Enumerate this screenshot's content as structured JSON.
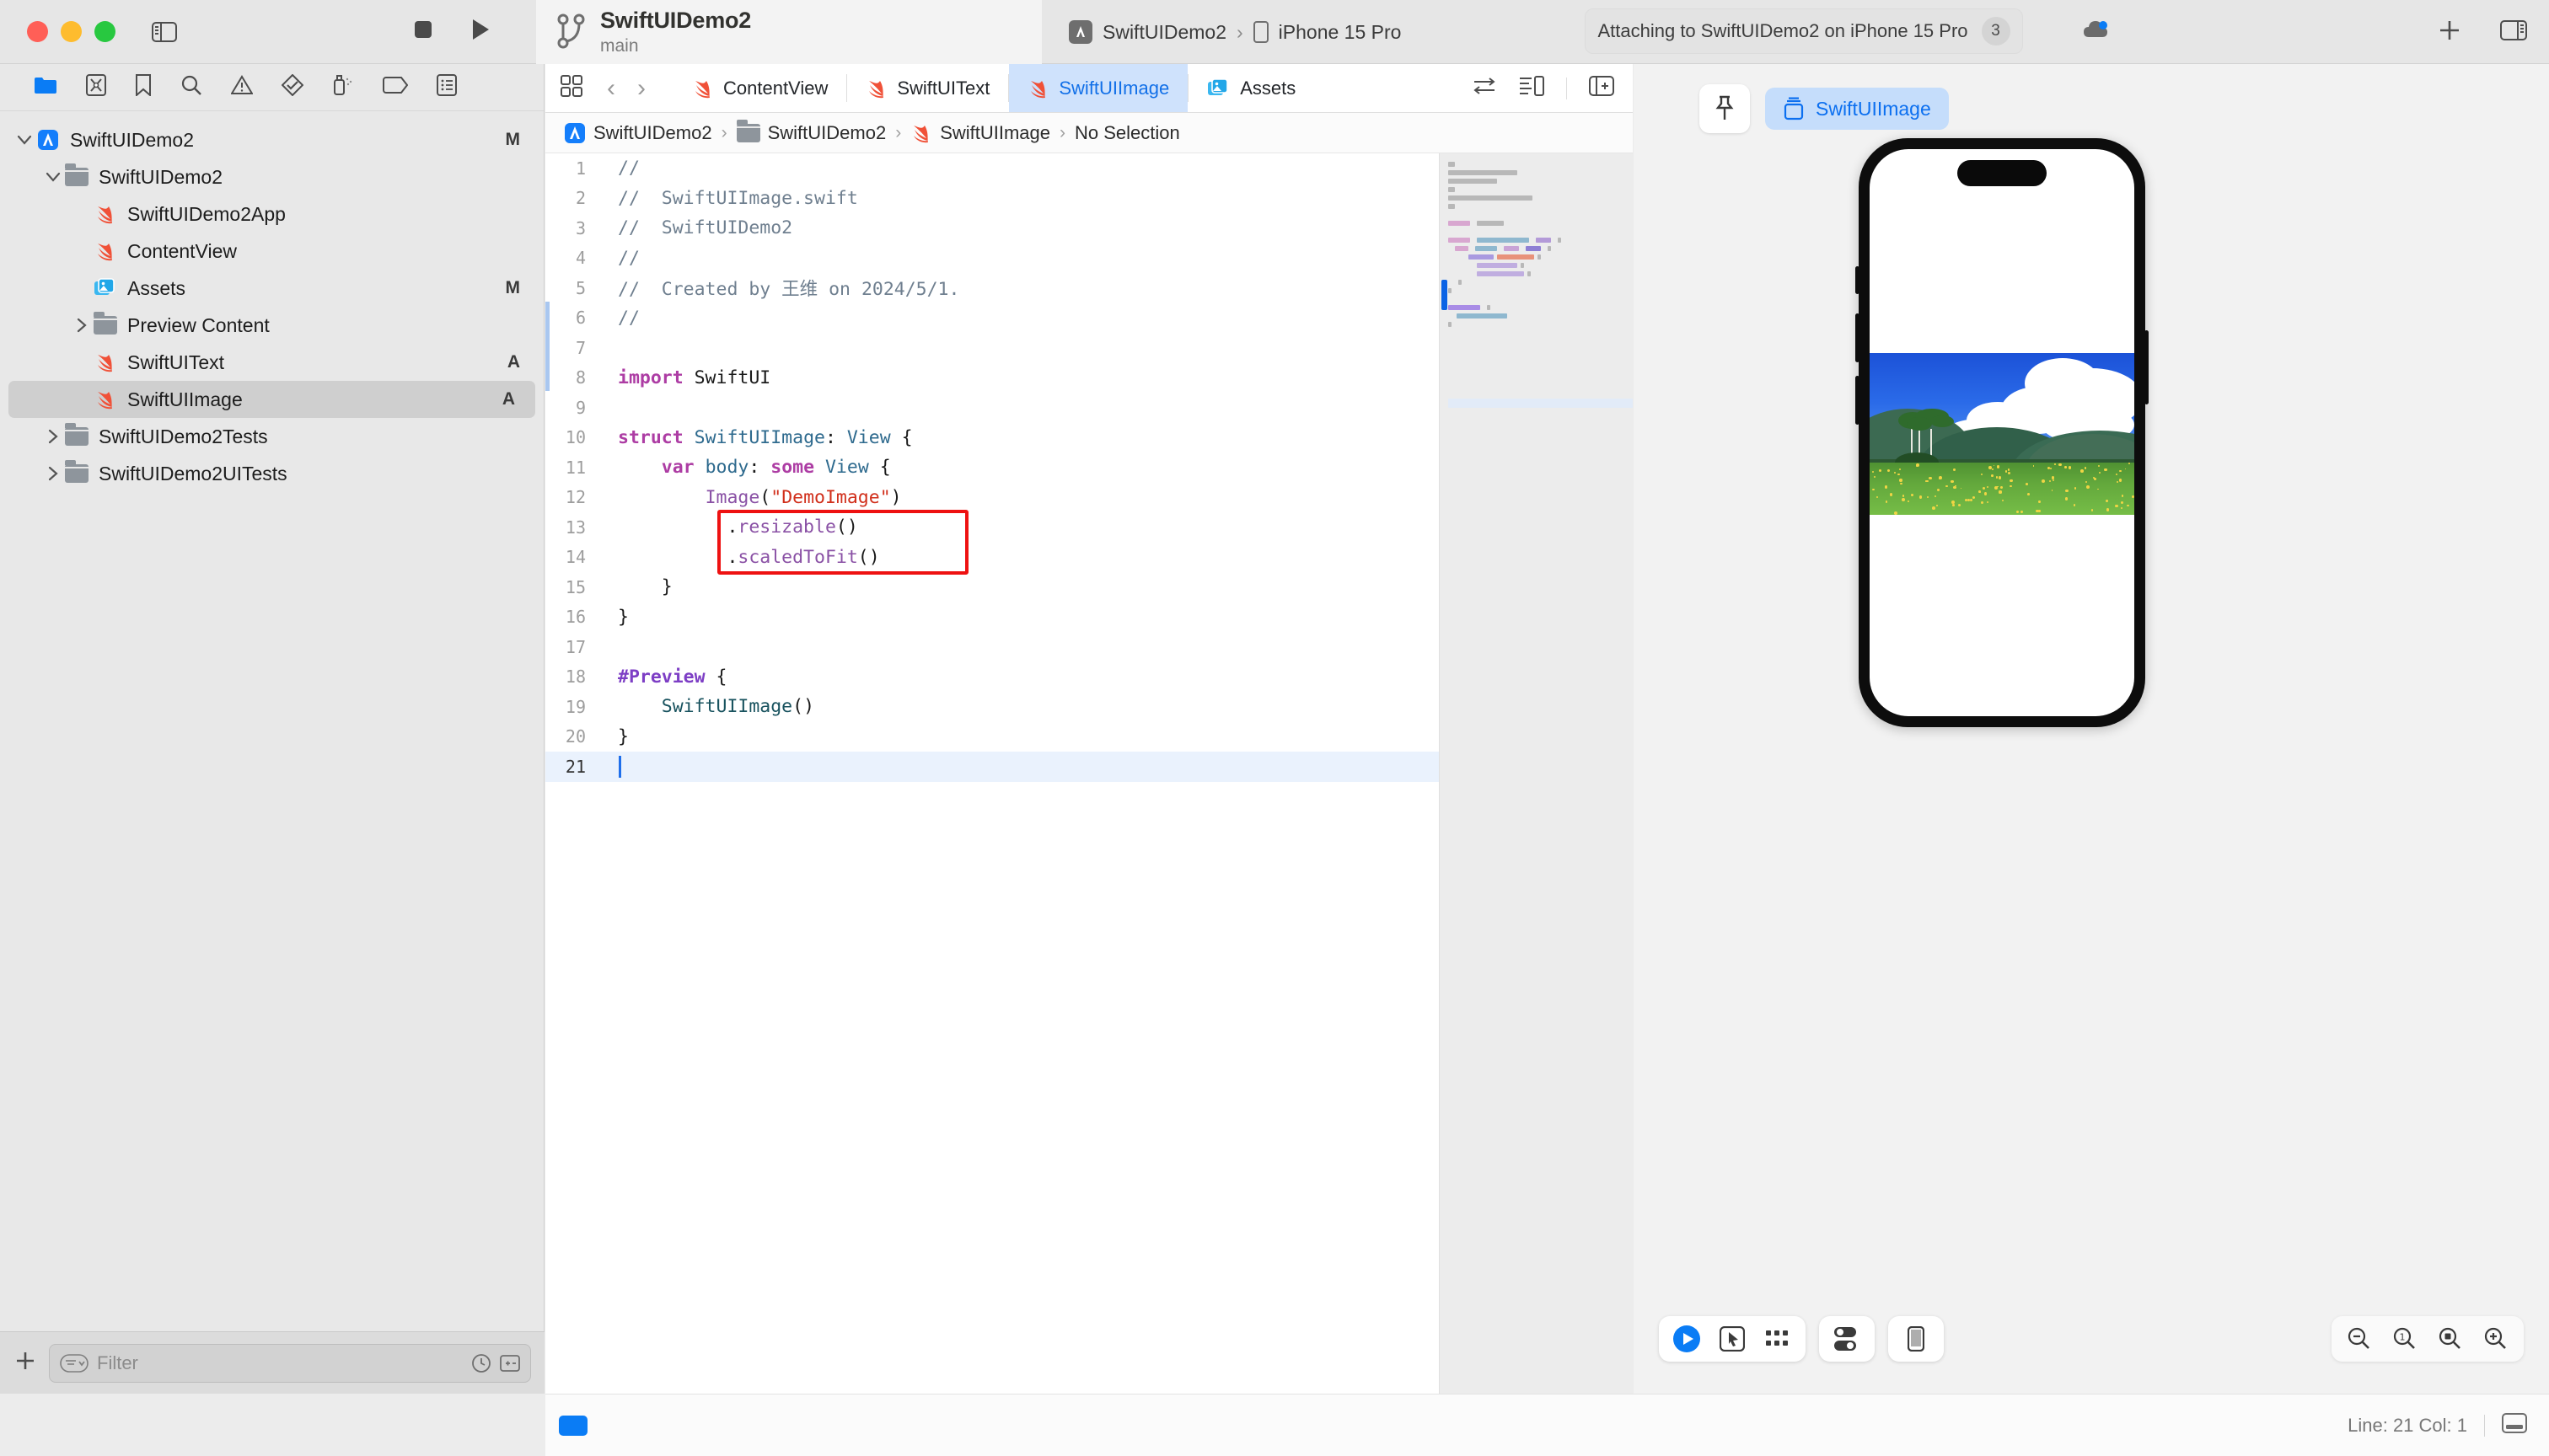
{
  "window": {
    "traffic_lights": [
      "close",
      "minimize",
      "zoom"
    ],
    "project_name": "SwiftUIDemo2",
    "branch": "main",
    "run_button": "run",
    "stop_button": "stop",
    "sidebar_toggle": "toggle-sidebar"
  },
  "destination": {
    "scheme": "SwiftUIDemo2",
    "separator": "›",
    "device": "iPhone 15 Pro"
  },
  "activity": {
    "message": "Attaching to SwiftUIDemo2 on iPhone 15 Pro",
    "issue_count": "3"
  },
  "toolbar_right": {
    "cloud": "cloud-icon",
    "add": "+",
    "inspector_toggle": "toggle-inspector"
  },
  "navigator": {
    "tabs": [
      {
        "name": "project-navigator",
        "icon": "folder-icon",
        "active": true
      },
      {
        "name": "source-control-navigator",
        "icon": "source-control-icon",
        "active": false
      },
      {
        "name": "bookmark-navigator",
        "icon": "bookmark-icon",
        "active": false
      },
      {
        "name": "find-navigator",
        "icon": "search-icon",
        "active": false
      },
      {
        "name": "issue-navigator",
        "icon": "warning-icon",
        "active": false
      },
      {
        "name": "test-navigator",
        "icon": "diamond-check-icon",
        "active": false
      },
      {
        "name": "debug-navigator",
        "icon": "spray-icon",
        "active": false
      },
      {
        "name": "breakpoint-navigator",
        "icon": "tag-icon",
        "active": false
      },
      {
        "name": "report-navigator",
        "icon": "report-icon",
        "active": false
      }
    ],
    "tree": [
      {
        "label": "SwiftUIDemo2",
        "icon": "xcode-project-icon",
        "depth": 0,
        "disclosure": "open",
        "status": "M",
        "selected": false
      },
      {
        "label": "SwiftUIDemo2",
        "icon": "folder-icon",
        "depth": 1,
        "disclosure": "open",
        "status": "",
        "selected": false
      },
      {
        "label": "SwiftUIDemo2App",
        "icon": "swift-file-icon",
        "depth": 2,
        "disclosure": "",
        "status": "",
        "selected": false
      },
      {
        "label": "ContentView",
        "icon": "swift-file-icon",
        "depth": 2,
        "disclosure": "",
        "status": "",
        "selected": false
      },
      {
        "label": "Assets",
        "icon": "assets-icon",
        "depth": 2,
        "disclosure": "",
        "status": "M",
        "selected": false
      },
      {
        "label": "Preview Content",
        "icon": "folder-icon",
        "depth": 2,
        "disclosure": "closed",
        "status": "",
        "selected": false
      },
      {
        "label": "SwiftUIText",
        "icon": "swift-file-icon",
        "depth": 2,
        "disclosure": "",
        "status": "A",
        "selected": false
      },
      {
        "label": "SwiftUIImage",
        "icon": "swift-file-icon",
        "depth": 2,
        "disclosure": "",
        "status": "A",
        "selected": true
      },
      {
        "label": "SwiftUIDemo2Tests",
        "icon": "folder-icon",
        "depth": 1,
        "disclosure": "closed",
        "status": "",
        "selected": false
      },
      {
        "label": "SwiftUIDemo2UITests",
        "icon": "folder-icon",
        "depth": 1,
        "disclosure": "closed",
        "status": "",
        "selected": false
      }
    ],
    "filter": {
      "placeholder": "Filter",
      "add_label": "+",
      "recent_icon": "clock-icon",
      "expand_icon": "expand-icon"
    }
  },
  "editor": {
    "tabs": [
      {
        "label": "ContentView",
        "icon": "swift-file-icon",
        "active": false
      },
      {
        "label": "SwiftUIText",
        "icon": "swift-file-icon",
        "active": false
      },
      {
        "label": "SwiftUIImage",
        "icon": "swift-file-icon",
        "active": true
      },
      {
        "label": "Assets",
        "icon": "assets-icon",
        "active": false
      }
    ],
    "tab_nav": {
      "back": "‹",
      "forward": "›",
      "grid": "editor-options-icon"
    },
    "tab_right_icons": [
      "code-review-icon",
      "split-lines-icon",
      "add-editor-icon"
    ],
    "breadcrumb": [
      {
        "label": "SwiftUIDemo2",
        "icon": "xcode-project-icon"
      },
      {
        "label": "SwiftUIDemo2",
        "icon": "folder-icon"
      },
      {
        "label": "SwiftUIImage",
        "icon": "swift-file-icon"
      },
      {
        "label": "No Selection",
        "icon": ""
      }
    ],
    "code_lines": [
      {
        "n": "1",
        "segments": [
          {
            "t": "//",
            "c": "cm"
          }
        ]
      },
      {
        "n": "2",
        "segments": [
          {
            "t": "//  SwiftUIImage.swift",
            "c": "cm"
          }
        ]
      },
      {
        "n": "3",
        "segments": [
          {
            "t": "//  SwiftUIDemo2",
            "c": "cm"
          }
        ]
      },
      {
        "n": "4",
        "segments": [
          {
            "t": "//",
            "c": "cm"
          }
        ]
      },
      {
        "n": "5",
        "segments": [
          {
            "t": "//  Created by 王维 on 2024/5/1.",
            "c": "cm"
          }
        ]
      },
      {
        "n": "6",
        "segments": [
          {
            "t": "//",
            "c": "cm"
          }
        ]
      },
      {
        "n": "7",
        "segments": []
      },
      {
        "n": "8",
        "segments": [
          {
            "t": "import",
            "c": "kw"
          },
          {
            "t": " SwiftUI",
            "c": "pl"
          }
        ]
      },
      {
        "n": "9",
        "segments": []
      },
      {
        "n": "10",
        "segments": [
          {
            "t": "struct",
            "c": "kw"
          },
          {
            "t": " ",
            "c": "pl"
          },
          {
            "t": "SwiftUIImage",
            "c": "ty"
          },
          {
            "t": ": ",
            "c": "pl"
          },
          {
            "t": "View",
            "c": "ty"
          },
          {
            "t": " {",
            "c": "pl"
          }
        ]
      },
      {
        "n": "11",
        "segments": [
          {
            "t": "    ",
            "c": "pl"
          },
          {
            "t": "var",
            "c": "kw"
          },
          {
            "t": " ",
            "c": "pl"
          },
          {
            "t": "body",
            "c": "ty"
          },
          {
            "t": ": ",
            "c": "pl"
          },
          {
            "t": "some",
            "c": "kw"
          },
          {
            "t": " ",
            "c": "pl"
          },
          {
            "t": "View",
            "c": "ty"
          },
          {
            "t": " {",
            "c": "pl"
          }
        ]
      },
      {
        "n": "12",
        "segments": [
          {
            "t": "        ",
            "c": "pl"
          },
          {
            "t": "Image",
            "c": "fn"
          },
          {
            "t": "(",
            "c": "pl"
          },
          {
            "t": "\"DemoImage\"",
            "c": "st"
          },
          {
            "t": ")",
            "c": "pl"
          }
        ]
      },
      {
        "n": "13",
        "segments": [
          {
            "t": "          .",
            "c": "pl"
          },
          {
            "t": "resizable",
            "c": "fn"
          },
          {
            "t": "()",
            "c": "pl"
          }
        ]
      },
      {
        "n": "14",
        "segments": [
          {
            "t": "          .",
            "c": "pl"
          },
          {
            "t": "scaledToFit",
            "c": "fn"
          },
          {
            "t": "()",
            "c": "pl"
          }
        ]
      },
      {
        "n": "15",
        "segments": [
          {
            "t": "    }",
            "c": "pl"
          }
        ]
      },
      {
        "n": "16",
        "segments": [
          {
            "t": "}",
            "c": "pl"
          }
        ]
      },
      {
        "n": "17",
        "segments": []
      },
      {
        "n": "18",
        "segments": [
          {
            "t": "#Preview",
            "c": "mac"
          },
          {
            "t": " {",
            "c": "pl"
          }
        ]
      },
      {
        "n": "19",
        "segments": [
          {
            "t": "    ",
            "c": "pl"
          },
          {
            "t": "SwiftUIImage",
            "c": "tydark"
          },
          {
            "t": "()",
            "c": "pl"
          }
        ]
      },
      {
        "n": "20",
        "segments": [
          {
            "t": "}",
            "c": "pl"
          }
        ]
      },
      {
        "n": "21",
        "segments": [],
        "active": true,
        "cursor": true
      }
    ],
    "annotation": {
      "color": "#ee1111",
      "covers_lines": [
        "13",
        "14"
      ]
    }
  },
  "preview": {
    "pin_button": "pin-icon",
    "badge_label": "SwiftUIImage",
    "badge_icon": "preview-device-icon",
    "device_frame": "iPhone 15 Pro",
    "image_name": "DemoImage",
    "image_description": "Landscape photo: blue sky with white cumulus clouds, green mountain ridges, birch trees at left, grassy meadow with yellow flowers",
    "controls": [
      {
        "name": "play-preview-button",
        "icon": "play-icon",
        "accent": "#0a7cf5"
      },
      {
        "name": "selection-tool-button",
        "icon": "pointer-icon"
      },
      {
        "name": "variants-button",
        "icon": "grid-icon"
      },
      {
        "name": "device-settings-button",
        "icon": "toggles-icon"
      },
      {
        "name": "device-picker-button",
        "icon": "device-icon"
      }
    ],
    "zoom_controls": [
      {
        "name": "zoom-out-button",
        "icon": "magnifier-minus-icon"
      },
      {
        "name": "zoom-actual-button",
        "icon": "magnifier-one-icon"
      },
      {
        "name": "zoom-fit-button",
        "icon": "magnifier-fit-icon"
      },
      {
        "name": "zoom-in-button",
        "icon": "magnifier-plus-icon"
      }
    ]
  },
  "statusbar": {
    "indicator": "editor-chip",
    "line_col": "Line: 21  Col: 1",
    "console_toggle": "toggle-console"
  }
}
